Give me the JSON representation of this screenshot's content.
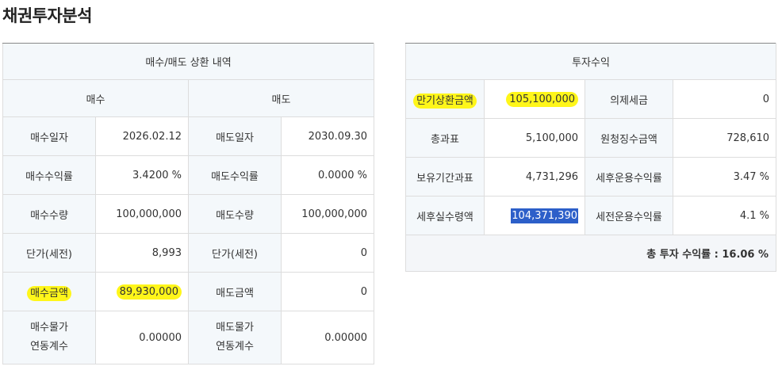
{
  "page_title": "채권투자분석",
  "left": {
    "section_title": "매수/매도 상환 내역",
    "buy_header": "매수",
    "sell_header": "매도",
    "rows": [
      {
        "buy_label": "매수일자",
        "buy_value": "2026.02.12",
        "sell_label": "매도일자",
        "sell_value": "2030.09.30"
      },
      {
        "buy_label": "매수수익률",
        "buy_value": "3.4200 %",
        "sell_label": "매도수익률",
        "sell_value": "0.0000 %"
      },
      {
        "buy_label": "매수수량",
        "buy_value": "100,000,000",
        "sell_label": "매도수량",
        "sell_value": "100,000,000"
      },
      {
        "buy_label": "단가(세전)",
        "buy_value": "8,993",
        "sell_label": "단가(세전)",
        "sell_value": "0"
      },
      {
        "buy_label": "매수금액",
        "buy_value": "89,930,000",
        "sell_label": "매도금액",
        "sell_value": "0"
      }
    ],
    "last_row": {
      "buy_label_1": "매수물가",
      "buy_label_2": "연동계수",
      "buy_value": "0.00000",
      "sell_label_1": "매도물가",
      "sell_label_2": "연동계수",
      "sell_value": "0.00000"
    }
  },
  "right": {
    "section_title": "투자수익",
    "rows": [
      {
        "label1": "만기상환금액",
        "value1": "105,100,000",
        "label2": "의제세금",
        "value2": "0"
      },
      {
        "label1": "총과표",
        "value1": "5,100,000",
        "label2": "원청징수금액",
        "value2": "728,610"
      },
      {
        "label1": "보유기간과표",
        "value1": "4,731,296",
        "label2": "세후운용수익률",
        "value2": "3.47 %"
      },
      {
        "label1": "세후실수령액",
        "value1": "104,371,390",
        "label2": "세전운용수익률",
        "value2": "4.1 %"
      }
    ],
    "total_text": "총 투자 수익률 : 16.06 %"
  },
  "colors": {
    "highlight": "#fff61a",
    "selection": "#2c5fc9",
    "header_bg": "#f4f8fb"
  }
}
